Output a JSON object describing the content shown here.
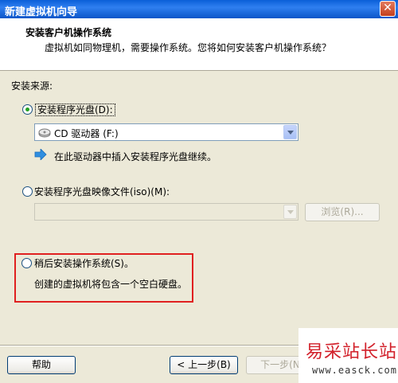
{
  "window": {
    "title": "新建虚拟机向导",
    "close_glyph": "✕"
  },
  "header": {
    "title": "安装客户机操作系统",
    "subtitle": "虚拟机如同物理机，需要操作系统。您将如何安装客户机操作系统？"
  },
  "install_source_label": "安装来源:",
  "option_disc": {
    "label": "安装程序光盘(D):",
    "selected": true,
    "drive_value": "CD 驱动器 (F:)",
    "hint": "在此驱动器中插入安装程序光盘继续。"
  },
  "option_iso": {
    "label": "安装程序光盘映像文件(iso)(M):",
    "selected": false,
    "path_value": "",
    "browse_label": "浏览(R)..."
  },
  "option_later": {
    "label": "稍后安装操作系统(S)。",
    "selected": false,
    "description": "创建的虚拟机将包含一个空白硬盘。"
  },
  "footer": {
    "help_label": "帮助",
    "back_label": "< 上一步(B)",
    "next_label": "下一步(N"
  },
  "watermark": {
    "text": "易采站长站",
    "url": "www.easck.com"
  },
  "colors": {
    "title_bar": "#0b55c8",
    "highlight_box": "#e02020",
    "hint_arrow": "#2f8ee0",
    "radio_dot": "#21a121"
  }
}
